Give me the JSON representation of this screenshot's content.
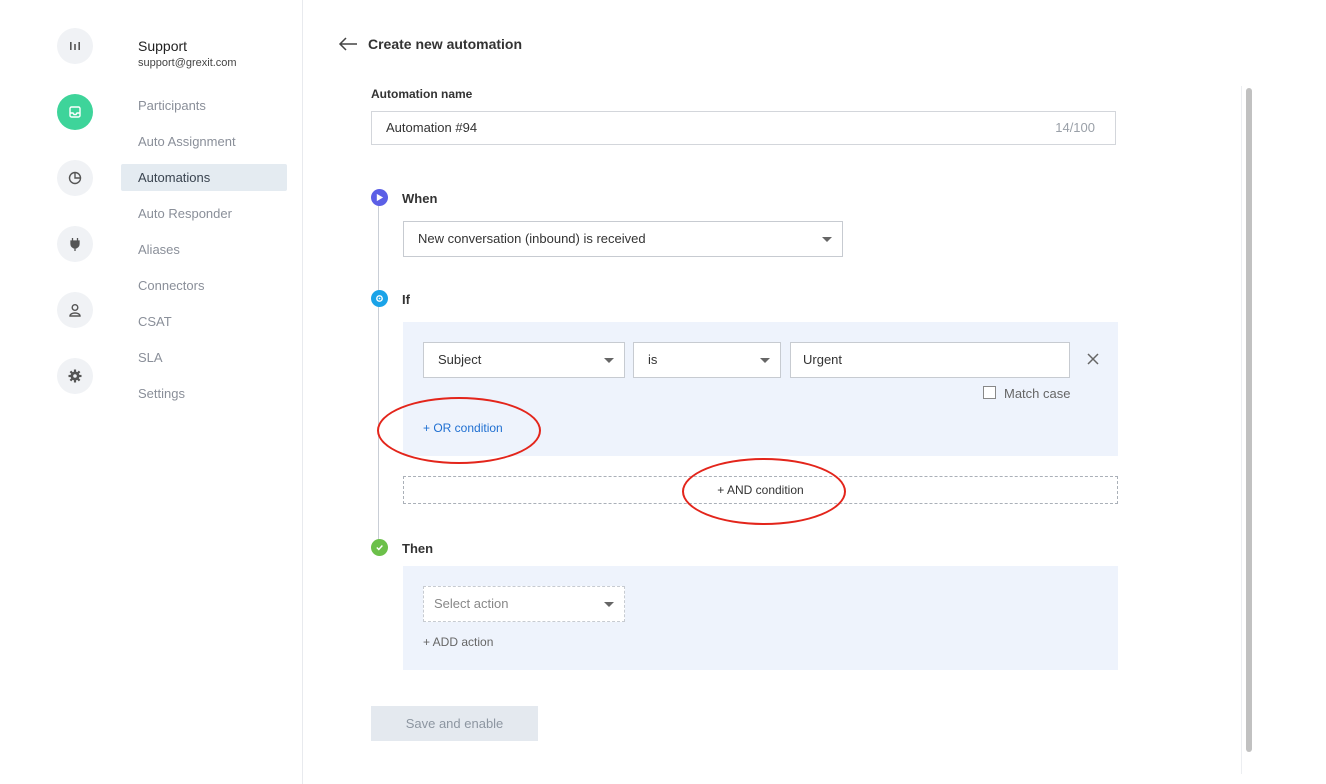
{
  "rail": {
    "icons": [
      "analytics-icon",
      "inbox-icon",
      "reports-icon",
      "integrations-plug-icon",
      "user-icon",
      "settings-gear-icon"
    ],
    "active_color": "#3ed49a"
  },
  "nav": {
    "title": "Support",
    "email": "support@grexit.com",
    "items": [
      {
        "label": "Participants"
      },
      {
        "label": "Auto Assignment"
      },
      {
        "label": "Automations"
      },
      {
        "label": "Auto Responder"
      },
      {
        "label": "Aliases"
      },
      {
        "label": "Connectors"
      },
      {
        "label": "CSAT"
      },
      {
        "label": "SLA"
      },
      {
        "label": "Settings"
      }
    ],
    "active_item": "Automations"
  },
  "header": {
    "title": "Create new automation"
  },
  "form": {
    "name_label": "Automation name",
    "name_value": "Automation #94",
    "name_counter": "14/100",
    "when": {
      "label": "When",
      "trigger_value": "New conversation (inbound) is received"
    },
    "if": {
      "label": "If",
      "condition": {
        "field": "Subject",
        "operator": "is",
        "value": "Urgent",
        "match_case_label": "Match case",
        "match_case_checked": false
      },
      "or_condition_label": "+ OR condition",
      "and_condition_label": "+ AND condition"
    },
    "then": {
      "label": "Then",
      "action_placeholder": "Select action",
      "add_action_label": "+ ADD action"
    },
    "save_label": "Save and enable"
  },
  "colors": {
    "when_dot": "#5b5fe6",
    "if_dot": "#1aa3e8",
    "then_dot": "#6cc04a",
    "link_blue": "#1f6fd1",
    "annotation_red": "#e3251b",
    "panel_bg": "#eef3fc"
  }
}
